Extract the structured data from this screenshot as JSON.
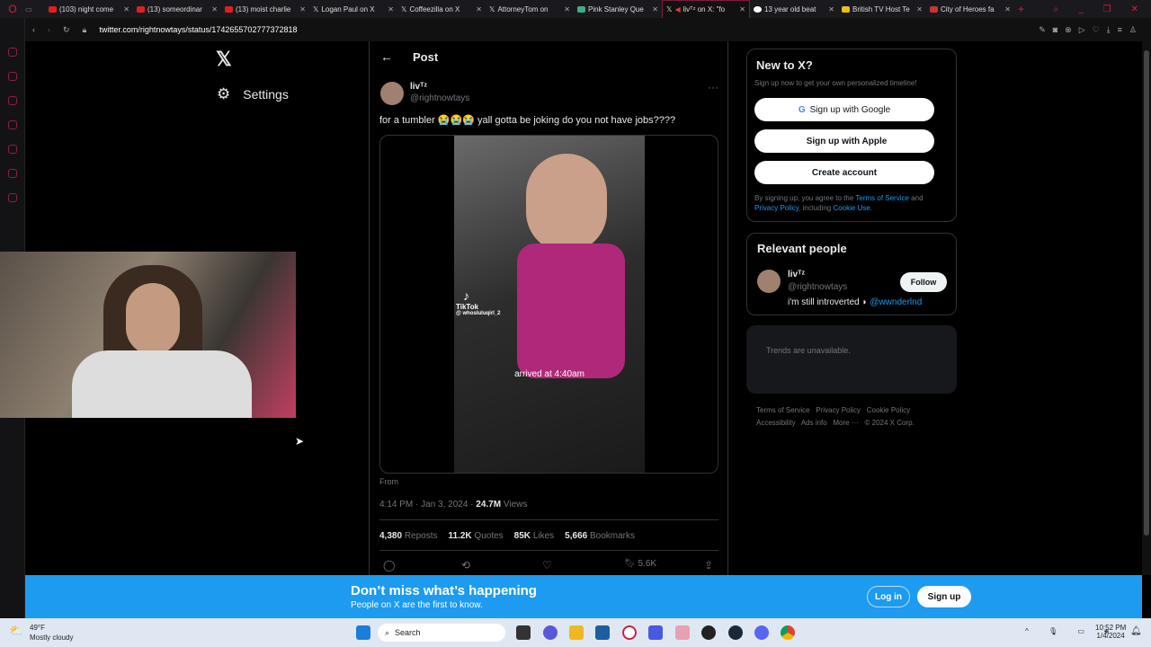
{
  "browser": {
    "tabs": [
      {
        "title": "(103) night come"
      },
      {
        "title": "(13) someordinar"
      },
      {
        "title": "(13) moist charlie"
      },
      {
        "title": "Logan Paul on X"
      },
      {
        "title": "Coffeezilla on X"
      },
      {
        "title": "AttorneyTom on"
      },
      {
        "title": "Pink Stanley Que"
      },
      {
        "title": "livᵀᶻ on X: \"fo"
      },
      {
        "title": "13 year old beat"
      },
      {
        "title": "British TV Host Te"
      },
      {
        "title": "City of Heroes fa"
      }
    ],
    "url": "twitter.com/rightnowtays/status/1742655702777372818"
  },
  "left": {
    "settings_label": "Settings"
  },
  "post": {
    "header": "Post",
    "author_name": "livᵀᶻ",
    "author_handle": "@rightnowtays",
    "text": "for a tumbler 😭😭😭 yall gotta be joking do you not have jobs????",
    "video_caption": "arrived at 4:40am",
    "tiktok_label": "TikTok",
    "tiktok_user": "@ whosluluqirl_2",
    "from_label": "From",
    "time": "4:14 PM · Jan 3, 2024 · ",
    "views_count": "24.7M",
    "views_label": " Views",
    "stats": {
      "reposts": "4,380",
      "reposts_label": "Reposts",
      "quotes": "11.2K",
      "quotes_label": "Quotes",
      "likes": "85K",
      "likes_label": "Likes",
      "bookmarks": "5,666",
      "bookmarks_label": "Bookmarks"
    },
    "bookmark_count": "5.6K"
  },
  "signup": {
    "title": "New to X?",
    "subtitle": "Sign up now to get your own personalized timeline!",
    "google": "Sign up with Google",
    "apple": "Sign up with Apple",
    "create": "Create account",
    "legal_1": "By signing up, you agree to the ",
    "tos": "Terms of Service",
    "and": " and",
    "privacy": "Privacy Policy",
    "including": ", including ",
    "cookie": "Cookie Use",
    "dot": "."
  },
  "relevant": {
    "title": "Relevant people",
    "name": "livᵀᶻ",
    "handle": "@rightnowtays",
    "bio": "i'm still introverted ◗ ",
    "bio_link": "@wwnderlnd",
    "follow": "Follow"
  },
  "trends": {
    "text": "Trends are unavailable."
  },
  "footer": {
    "links": [
      "Terms of Service",
      "Privacy Policy",
      "Cookie Policy",
      "Accessibility",
      "Ads info",
      "More ···",
      "© 2024 X Corp."
    ]
  },
  "banner": {
    "title": "Don’t miss what’s happening",
    "subtitle": "People on X are the first to know.",
    "login": "Log in",
    "signup": "Sign up"
  },
  "taskbar": {
    "temp": "49°F",
    "weather": "Mostly cloudy",
    "search": "Search",
    "time": "10:52 PM",
    "date": "1/4/2024"
  },
  "colors": {
    "accent": "#1d9bf0",
    "bg": "#000000"
  }
}
